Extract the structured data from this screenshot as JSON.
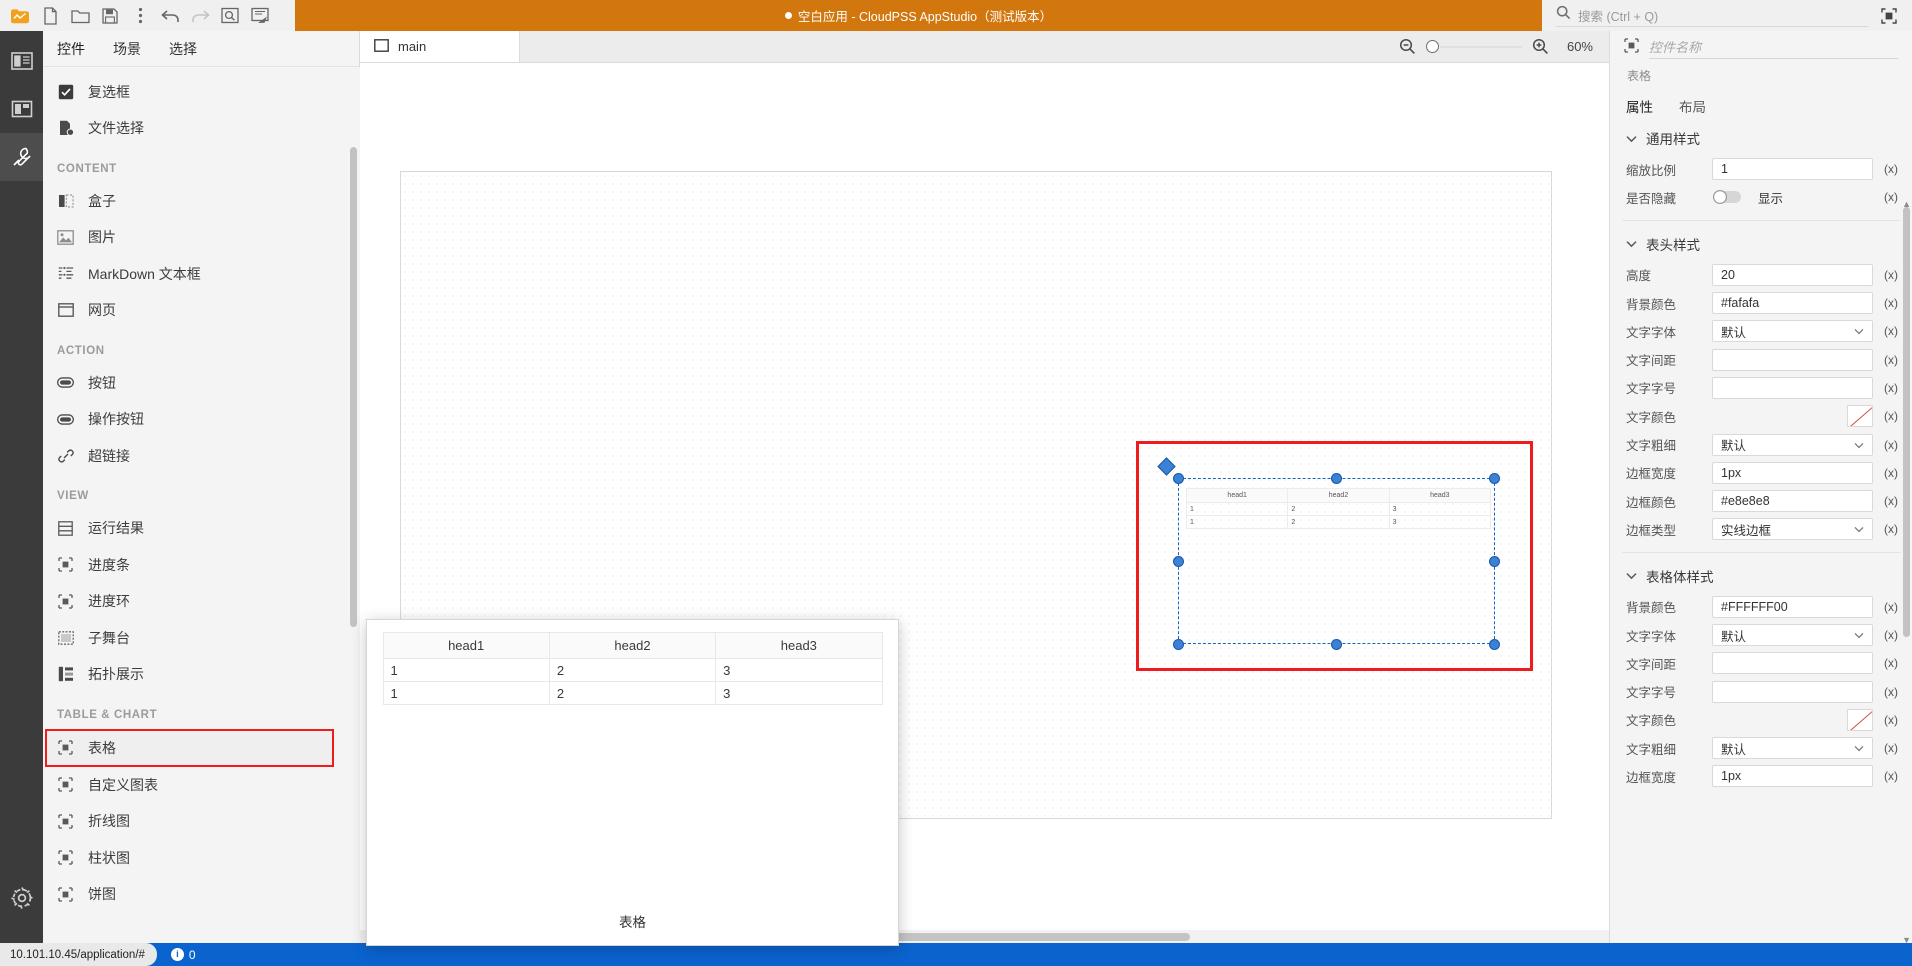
{
  "titlebar": {
    "app_title": "空白应用 - CloudPSS AppStudio（测试版本）",
    "toolbar_icons": [
      {
        "name": "app-logo-icon",
        "glyph": "logo"
      },
      {
        "name": "new-file-icon",
        "glyph": "file"
      },
      {
        "name": "open-folder-icon",
        "glyph": "folder"
      },
      {
        "name": "save-icon",
        "glyph": "save"
      },
      {
        "name": "more-options-icon",
        "glyph": "dots"
      },
      {
        "name": "undo-icon",
        "glyph": "undo"
      },
      {
        "name": "redo-icon",
        "glyph": "redo"
      },
      {
        "name": "preview-icon",
        "glyph": "preview"
      },
      {
        "name": "publish-icon",
        "glyph": "publish"
      }
    ],
    "search_placeholder": "搜索 (Ctrl + Q)",
    "maximize_label": "maximize"
  },
  "rail": {
    "items": [
      {
        "name": "rail-item-pages",
        "icon": "layout-icon"
      },
      {
        "name": "rail-item-components",
        "icon": "box-icon"
      },
      {
        "name": "rail-item-tools",
        "icon": "wrench-icon",
        "active": true
      }
    ],
    "settings": {
      "name": "rail-item-settings",
      "icon": "gear-icon"
    }
  },
  "left_panel": {
    "tabs": [
      {
        "label": "控件",
        "active": true
      },
      {
        "label": "场景",
        "active": false
      },
      {
        "label": "选择",
        "active": false
      }
    ],
    "groups": [
      {
        "title": "",
        "items": [
          {
            "label": "复选框",
            "icon": "checkbox-icon"
          },
          {
            "label": "文件选择",
            "icon": "file-picker-icon"
          }
        ]
      },
      {
        "title": "CONTENT",
        "items": [
          {
            "label": "盒子",
            "icon": "box-icon"
          },
          {
            "label": "图片",
            "icon": "image-icon"
          },
          {
            "label": "MarkDown 文本框",
            "icon": "markdown-icon"
          },
          {
            "label": "网页",
            "icon": "webpage-icon"
          }
        ]
      },
      {
        "title": "ACTION",
        "items": [
          {
            "label": "按钮",
            "icon": "button-icon"
          },
          {
            "label": "操作按钮",
            "icon": "action-button-icon"
          },
          {
            "label": "超链接",
            "icon": "link-icon"
          }
        ]
      },
      {
        "title": "VIEW",
        "items": [
          {
            "label": "运行结果",
            "icon": "result-icon"
          },
          {
            "label": "进度条",
            "icon": "progress-bar-icon"
          },
          {
            "label": "进度环",
            "icon": "progress-ring-icon"
          },
          {
            "label": "子舞台",
            "icon": "substage-icon"
          },
          {
            "label": "拓扑展示",
            "icon": "topology-icon"
          }
        ]
      },
      {
        "title": "TABLE & CHART",
        "items": [
          {
            "label": "表格",
            "icon": "table-icon",
            "highlighted": true
          },
          {
            "label": "自定义图表",
            "icon": "custom-chart-icon"
          },
          {
            "label": "折线图",
            "icon": "line-chart-icon"
          },
          {
            "label": "柱状图",
            "icon": "bar-chart-icon"
          },
          {
            "label": "饼图",
            "icon": "pie-chart-icon"
          }
        ]
      }
    ]
  },
  "preview_popup": {
    "caption": "表格",
    "table": {
      "headers": [
        "head1",
        "head2",
        "head3"
      ],
      "rows": [
        [
          "1",
          "2",
          "3"
        ],
        [
          "1",
          "2",
          "3"
        ]
      ]
    }
  },
  "center": {
    "tab": {
      "label": "main",
      "icon": "page-icon"
    },
    "zoom": {
      "out_icon": "zoom-out-icon",
      "in_icon": "zoom-in-icon",
      "level": "60%"
    },
    "canvas_table": {
      "headers": [
        "head1",
        "head2",
        "head3"
      ],
      "rows": [
        [
          "1",
          "2",
          "3"
        ],
        [
          "1",
          "2",
          "3"
        ]
      ]
    }
  },
  "right_panel": {
    "name_placeholder": "控件名称",
    "name_value": "",
    "component_type": "表格",
    "type_icon": "table-icon",
    "tabs": [
      {
        "label": "属性",
        "active": true
      },
      {
        "label": "布局",
        "active": false
      }
    ],
    "sections": [
      {
        "title": "通用样式",
        "rows": [
          {
            "label": "缩放比例",
            "kind": "text",
            "value": "1",
            "suffix": "(x)"
          },
          {
            "label": "是否隐藏",
            "kind": "toggle",
            "value": "显示",
            "suffix": "(x)"
          }
        ]
      },
      {
        "title": "表头样式",
        "rows": [
          {
            "label": "高度",
            "kind": "text",
            "value": "20",
            "suffix": "(x)"
          },
          {
            "label": "背景颜色",
            "kind": "text",
            "value": "#fafafa",
            "suffix": "(x)"
          },
          {
            "label": "文字字体",
            "kind": "select",
            "value": "默认",
            "suffix": "(x)"
          },
          {
            "label": "文字间距",
            "kind": "text",
            "value": "",
            "suffix": "(x)"
          },
          {
            "label": "文字字号",
            "kind": "text",
            "value": "",
            "suffix": "(x)"
          },
          {
            "label": "文字颜色",
            "kind": "color",
            "value": "",
            "suffix": "(x)"
          },
          {
            "label": "文字粗细",
            "kind": "select",
            "value": "默认",
            "suffix": "(x)"
          },
          {
            "label": "边框宽度",
            "kind": "text",
            "value": "1px",
            "suffix": "(x)"
          },
          {
            "label": "边框颜色",
            "kind": "text",
            "value": "#e8e8e8",
            "suffix": "(x)"
          },
          {
            "label": "边框类型",
            "kind": "select",
            "value": "实线边框",
            "suffix": "(x)"
          }
        ]
      },
      {
        "title": "表格体样式",
        "rows": [
          {
            "label": "背景颜色",
            "kind": "text",
            "value": "#FFFFFF00",
            "suffix": "(x)"
          },
          {
            "label": "文字字体",
            "kind": "select",
            "value": "默认",
            "suffix": "(x)"
          },
          {
            "label": "文字间距",
            "kind": "text",
            "value": "",
            "suffix": "(x)"
          },
          {
            "label": "文字字号",
            "kind": "text",
            "value": "",
            "suffix": "(x)"
          },
          {
            "label": "文字颜色",
            "kind": "color",
            "value": "",
            "suffix": "(x)"
          },
          {
            "label": "文字粗细",
            "kind": "select",
            "value": "默认",
            "suffix": "(x)"
          },
          {
            "label": "边框宽度",
            "kind": "text",
            "value": "1px",
            "suffix": "(x)"
          }
        ]
      }
    ]
  },
  "statusbar": {
    "url": "10.101.10.45/application/#",
    "info_count": "0",
    "info_icon": "info-icon"
  },
  "colors": {
    "brand_orange": "#d2760e",
    "status_blue": "#0b63ce",
    "selection_red": "#ee1c1c",
    "handle_blue": "#3b82d6"
  }
}
